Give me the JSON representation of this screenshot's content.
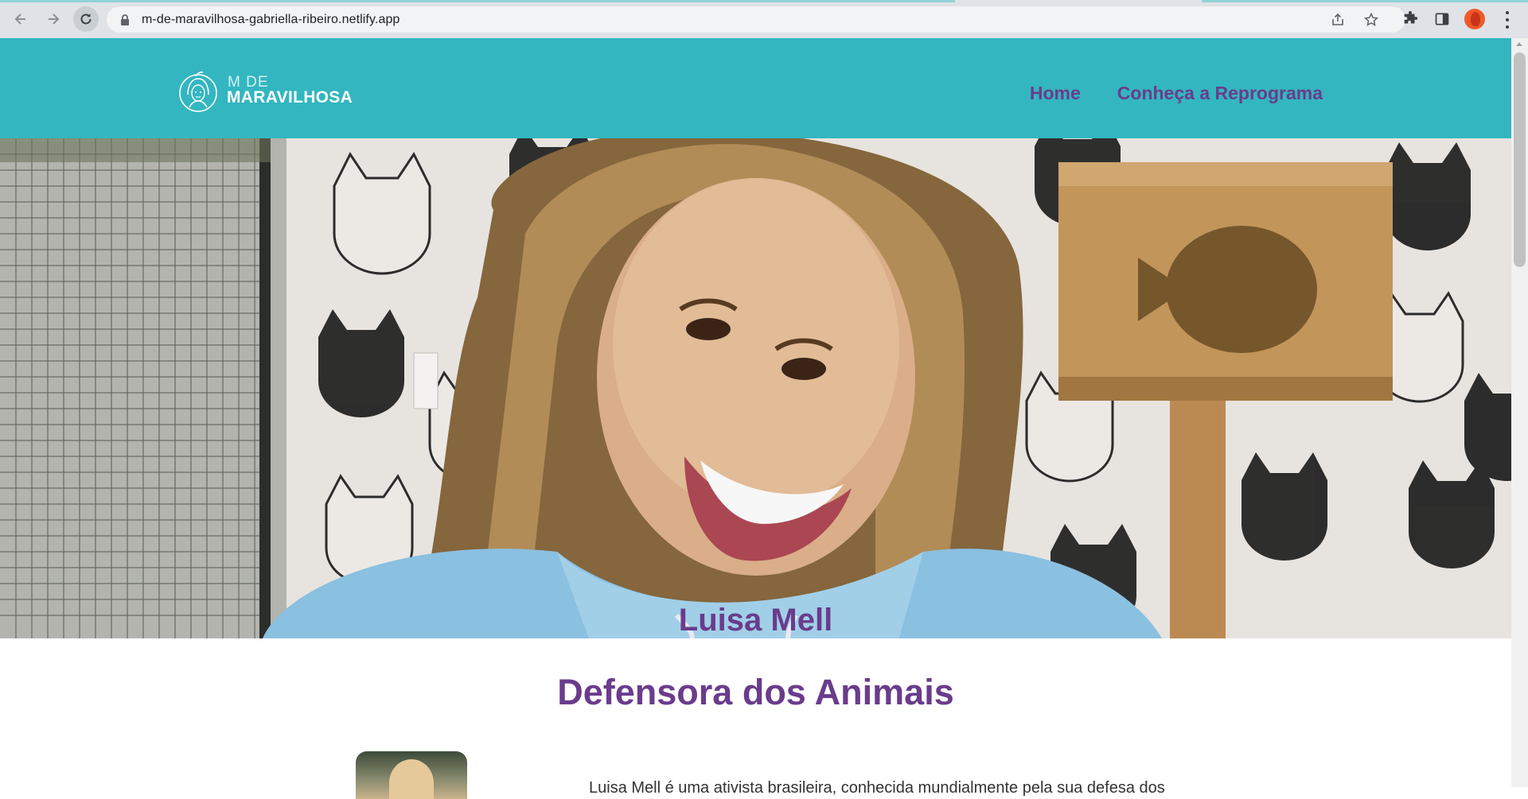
{
  "browser": {
    "url": "m-de-maravilhosa-gabriella-ribeiro.netlify.app",
    "icons": {
      "back": "back-arrow-icon",
      "forward": "forward-arrow-icon",
      "reload": "reload-icon",
      "lock": "lock-icon",
      "share": "share-icon",
      "bookmark": "star-icon",
      "extensions": "puzzle-icon",
      "side_panel": "side-panel-icon",
      "profile": "avatar",
      "menu": "kebab-menu-icon"
    }
  },
  "site": {
    "brand_color": "#33b6c0",
    "accent_color": "#6a3c8c",
    "logo": {
      "line1": "M DE",
      "line2": "MARAVILHOSA"
    },
    "nav": [
      {
        "label": "Home"
      },
      {
        "label": "Conheça a Reprograma"
      }
    ]
  },
  "hero": {
    "name": "Luisa Mell"
  },
  "content": {
    "title": "Defensora dos Animais",
    "intro": "Luisa Mell é uma ativista brasileira, conhecida mundialmente pela sua defesa dos"
  }
}
